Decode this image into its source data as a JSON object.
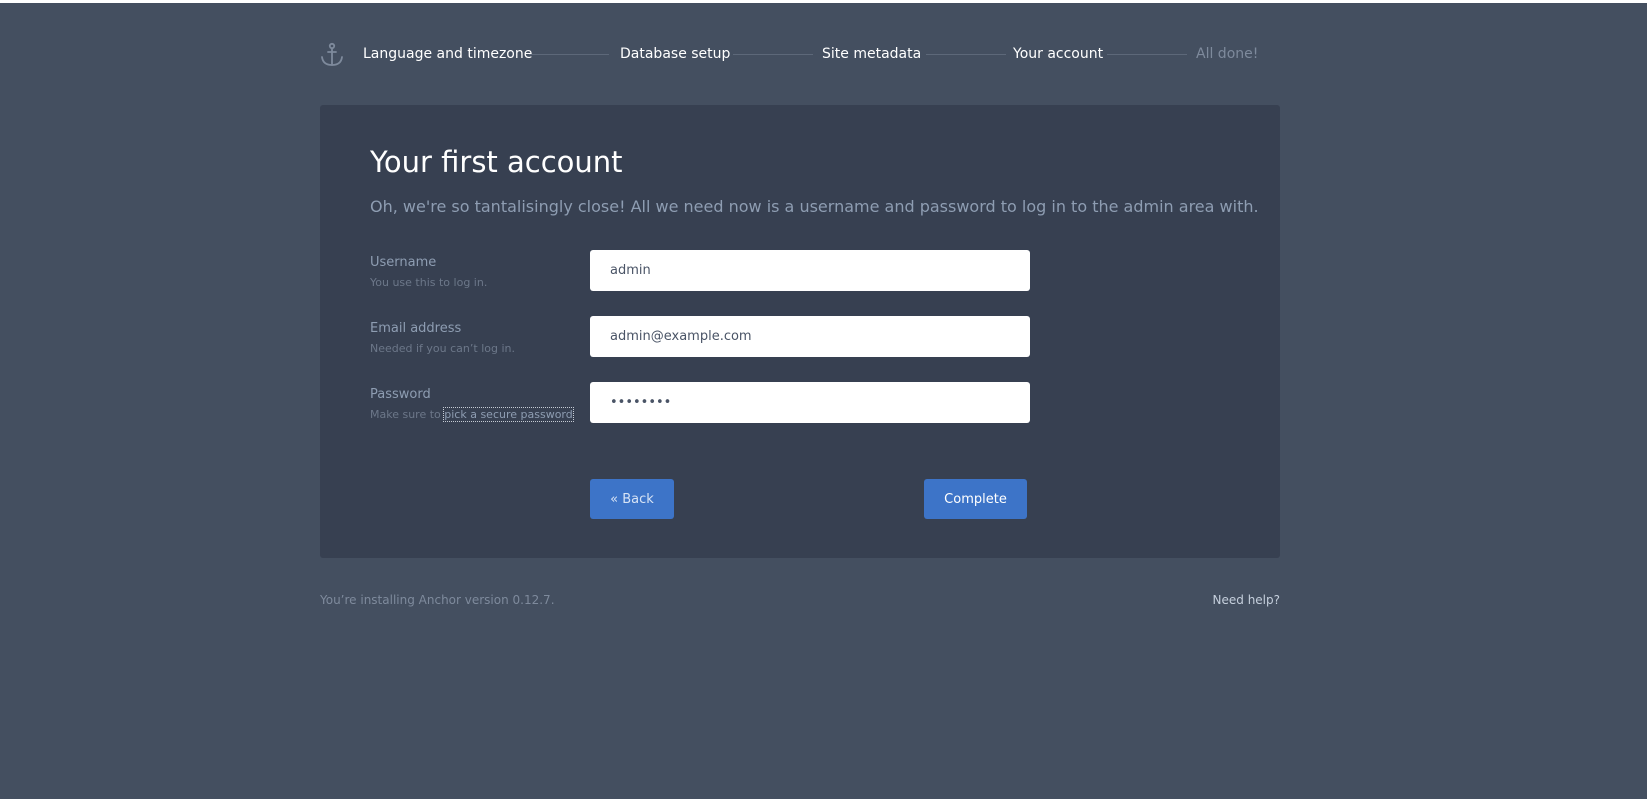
{
  "steps": [
    {
      "label": "Language and timezone",
      "state": "done"
    },
    {
      "label": "Database setup",
      "state": "done"
    },
    {
      "label": "Site metadata",
      "state": "done"
    },
    {
      "label": "Your account",
      "state": "current"
    },
    {
      "label": "All done!",
      "state": "pending"
    }
  ],
  "page": {
    "title": "Your first account",
    "lead": "Oh, we're so tantalisingly close! All we need now is a username and password to log in to the admin area with."
  },
  "form": {
    "username": {
      "label": "Username",
      "hint": "You use this to log in.",
      "value": "admin"
    },
    "email": {
      "label": "Email address",
      "hint": "Needed if you can’t log in.",
      "value": "admin@example.com"
    },
    "password": {
      "label": "Password",
      "hint_prefix": "Make sure to ",
      "hint_link": "pick a secure password",
      "value": "password"
    }
  },
  "buttons": {
    "back": "« Back",
    "complete": "Complete"
  },
  "footer": {
    "version_text": "You’re installing Anchor version 0.12.7.",
    "help_link": "Need help?"
  },
  "icons": {
    "logo": "anchor-icon"
  },
  "colors": {
    "background": "#444f60",
    "card": "#374051",
    "button": "#3d74c8",
    "muted_text": "#8e9db2"
  }
}
